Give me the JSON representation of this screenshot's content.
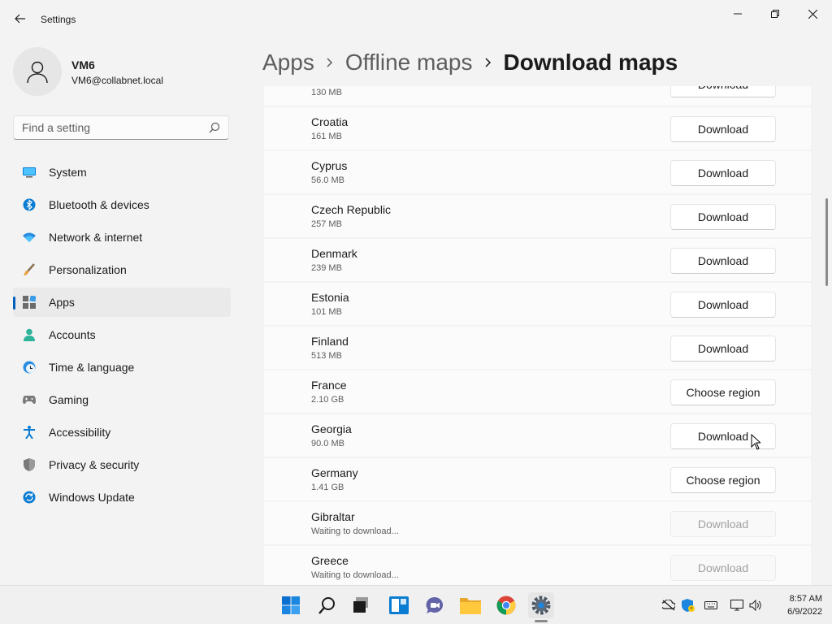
{
  "window": {
    "title": "Settings"
  },
  "profile": {
    "name": "VM6",
    "email": "VM6@collabnet.local"
  },
  "search": {
    "placeholder": "Find a setting",
    "value": ""
  },
  "nav": [
    {
      "label": "System",
      "icon": "monitor-icon",
      "active": false
    },
    {
      "label": "Bluetooth & devices",
      "icon": "bluetooth-icon",
      "active": false
    },
    {
      "label": "Network & internet",
      "icon": "wifi-icon",
      "active": false
    },
    {
      "label": "Personalization",
      "icon": "brush-icon",
      "active": false
    },
    {
      "label": "Apps",
      "icon": "apps-icon",
      "active": true
    },
    {
      "label": "Accounts",
      "icon": "person-icon",
      "active": false
    },
    {
      "label": "Time & language",
      "icon": "clock-globe-icon",
      "active": false
    },
    {
      "label": "Gaming",
      "icon": "gamepad-icon",
      "active": false
    },
    {
      "label": "Accessibility",
      "icon": "accessibility-icon",
      "active": false
    },
    {
      "label": "Privacy & security",
      "icon": "shield-icon",
      "active": false
    },
    {
      "label": "Windows Update",
      "icon": "update-icon",
      "active": false
    }
  ],
  "breadcrumb": {
    "items": [
      "Apps",
      "Offline maps"
    ],
    "current": "Download maps"
  },
  "maps": [
    {
      "name": "",
      "size": "130 MB",
      "action": "Download",
      "disabled": false
    },
    {
      "name": "Croatia",
      "size": "161 MB",
      "action": "Download",
      "disabled": false
    },
    {
      "name": "Cyprus",
      "size": "56.0 MB",
      "action": "Download",
      "disabled": false
    },
    {
      "name": "Czech Republic",
      "size": "257 MB",
      "action": "Download",
      "disabled": false
    },
    {
      "name": "Denmark",
      "size": "239 MB",
      "action": "Download",
      "disabled": false
    },
    {
      "name": "Estonia",
      "size": "101 MB",
      "action": "Download",
      "disabled": false
    },
    {
      "name": "Finland",
      "size": "513 MB",
      "action": "Download",
      "disabled": false
    },
    {
      "name": "France",
      "size": "2.10 GB",
      "action": "Choose region",
      "disabled": false
    },
    {
      "name": "Georgia",
      "size": "90.0 MB",
      "action": "Download",
      "disabled": false
    },
    {
      "name": "Germany",
      "size": "1.41 GB",
      "action": "Choose region",
      "disabled": false
    },
    {
      "name": "Gibraltar",
      "size": "Waiting to download...",
      "action": "Download",
      "disabled": true
    },
    {
      "name": "Greece",
      "size": "Waiting to download...",
      "action": "Download",
      "disabled": true
    }
  ],
  "taskbar": {
    "apps": [
      "start-icon",
      "search-icon",
      "task-view-icon",
      "widgets-icon",
      "chat-icon",
      "file-explorer-icon",
      "chrome-icon",
      "settings-icon"
    ],
    "active_app": "settings-icon",
    "tray": [
      "network-off-icon",
      "security-shield-icon",
      "keyboard-icon",
      "display-icon",
      "volume-icon"
    ]
  },
  "clock": {
    "time": "8:57 AM",
    "date": "6/9/2022"
  },
  "colors": {
    "accent": "#005fb8",
    "background": "#f3f3f3",
    "card": "#fbfbfb"
  }
}
